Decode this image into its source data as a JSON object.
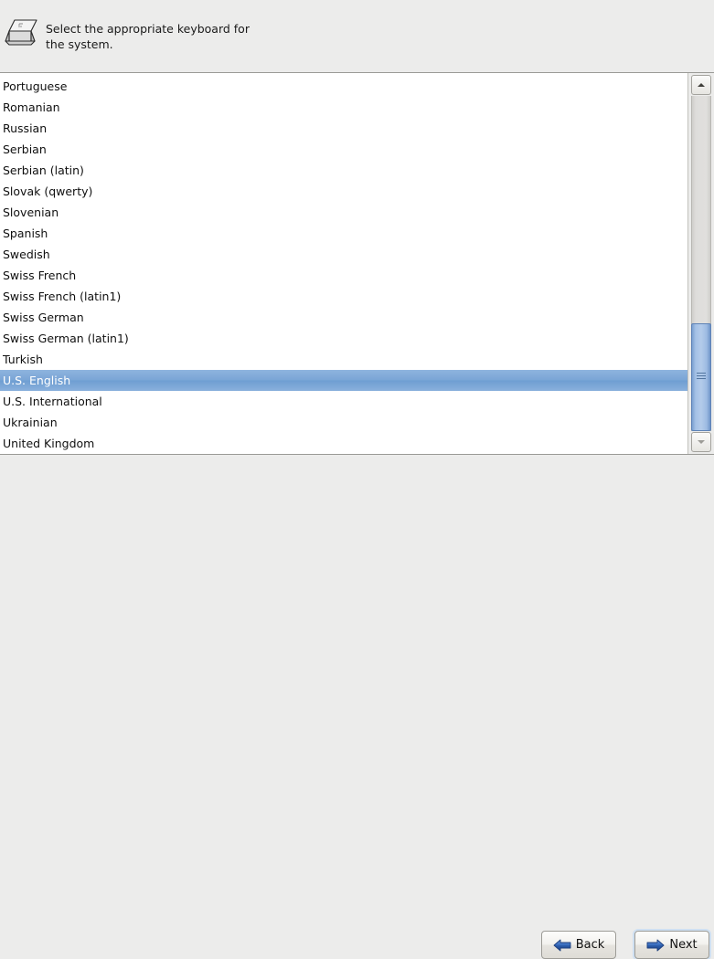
{
  "header": {
    "icon": "keyboard-key-icon",
    "line1": "Select the appropriate keyboard for",
    "line2": "the system."
  },
  "keyboard_list": {
    "selected": "U.S. English",
    "items": [
      "Portuguese",
      "Romanian",
      "Russian",
      "Serbian",
      "Serbian (latin)",
      "Slovak (qwerty)",
      "Slovenian",
      "Spanish",
      "Swedish",
      "Swiss French",
      "Swiss French (latin1)",
      "Swiss German",
      "Swiss German (latin1)",
      "Turkish",
      "U.S. English",
      "U.S. International",
      "Ukrainian",
      "United Kingdom"
    ]
  },
  "scrollbar": {
    "up_icon": "triangle-up-icon",
    "down_icon": "triangle-down-icon",
    "grip_icon": "grip-lines-icon"
  },
  "footer": {
    "back_label": "Back",
    "back_icon": "arrow-left-icon",
    "next_label": "Next",
    "next_icon": "arrow-right-icon"
  },
  "colors": {
    "background": "#ececeb",
    "list_background": "#ffffff",
    "selection_blue": "#7aa5d6",
    "selection_text": "#ffffff",
    "arrow_blue": "#2b5aa8",
    "border": "#9a9a96"
  }
}
